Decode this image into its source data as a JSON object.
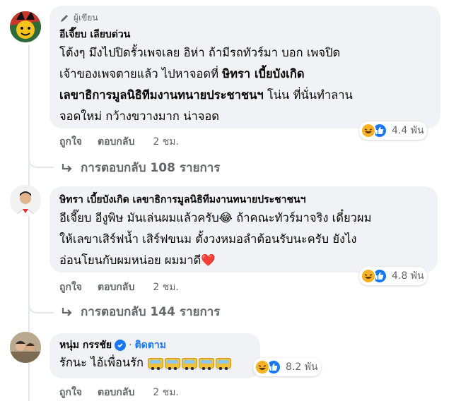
{
  "comments": [
    {
      "badge": "ผู้เขียน",
      "author": "อีเจี๊ยบ เลียบด่วน",
      "line1": "โต้งๆ มึงไปปิดรั้วเพจเลย อิห่า ถ้ามีรถทัวร์มา บอก เพจปิด",
      "line2_pre": "เจ้าของเพจตายแล้ว ไปหาจอดที่ ",
      "line2_bold": "ษิทรา เบี้ยบังเกิด",
      "line3_bold": "เลขาธิการมูลนิธิทีมงานทนายประชาชนฯ",
      "line3_post": " โน่น ที่นั่นทำลาน",
      "line4": "จอดใหม่ กว้างขวางมาก น่าจอด",
      "reaction_count": "4.4 พัน",
      "like_label": "ถูกใจ",
      "reply_label": "ตอบกลับ",
      "time": "2 ชม.",
      "replies_label": "การตอบกลับ 108 รายการ"
    },
    {
      "author": "ษิทรา เบี้ยบังเกิด เลขาธิการมูลนิธิทีมงานทนายประชาชนฯ",
      "line1": "อีเจี๊ยบ อีงูพิษ มันเล่นผมแล้วครับ😂 ถ้าคณะทัวร์มาจริง เดี๋ยวผม",
      "line2": "ให้เลขาเสิร์ฟน้ำ เสิร์ฟขนม ตั้งวงหมอลำต้อนรับนะครับ ยังไง",
      "line3": "อ่อนโยนกับผมหน่อย ผมมาดี❤️",
      "reaction_count": "4.8 พัน",
      "like_label": "ถูกใจ",
      "reply_label": "ตอบกลับ",
      "time": "2 ชม.",
      "replies_label": "การตอบกลับ 144 รายการ"
    },
    {
      "author": "หนุ่ม กรรชัย",
      "follow_label": "ติดตาม",
      "text": "รักนะ ไอ้เพื่อนรัก",
      "reaction_count": "8.2 พัน",
      "like_label": "ถูกใจ",
      "reply_label": "ตอบกลับ",
      "time": "2 ชม."
    }
  ],
  "colors": {
    "bubble": "#f0f2f5",
    "muted": "#65676b",
    "link": "#1877f2",
    "haha": "#f7b125",
    "like": "#1877f2"
  },
  "icons": [
    "pencil-icon",
    "haha-reaction-icon",
    "like-reaction-icon",
    "reply-arrow-icon",
    "verified-icon",
    "bus-emoji-icon"
  ]
}
